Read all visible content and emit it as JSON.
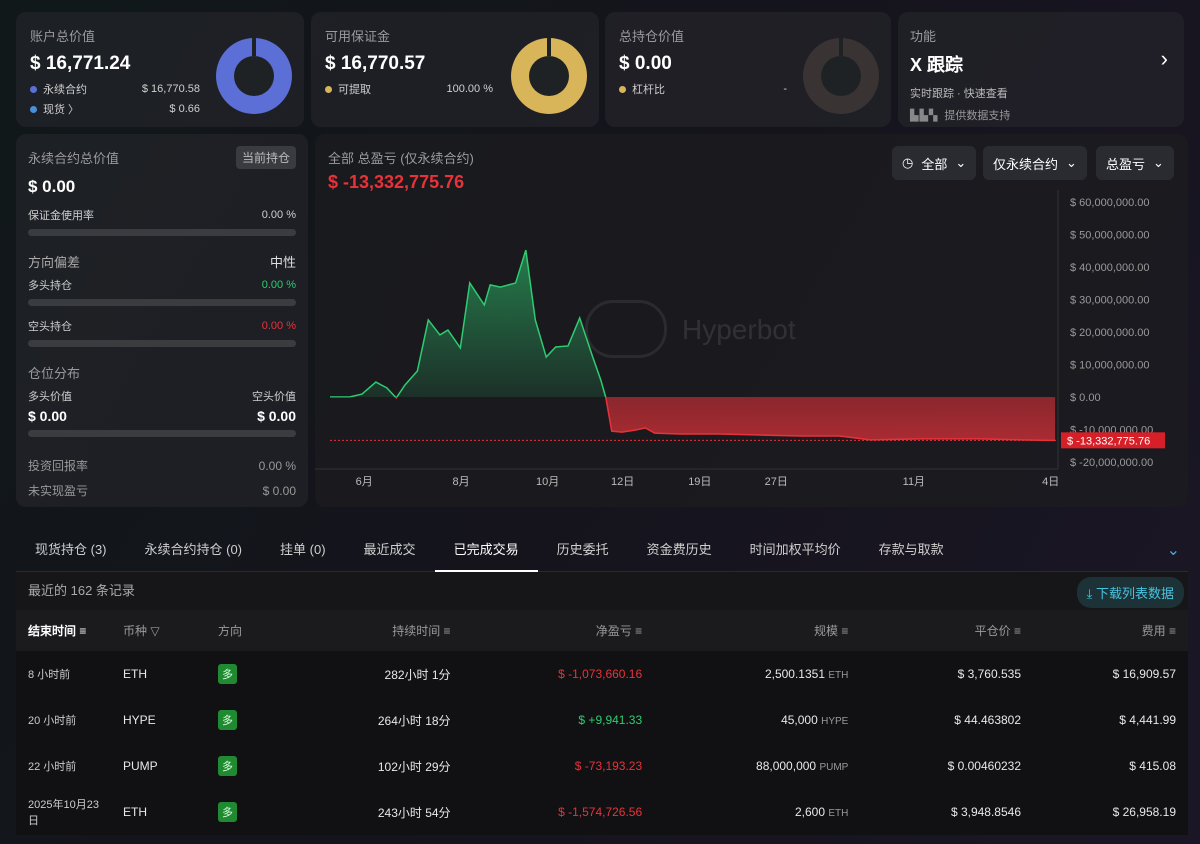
{
  "cards": {
    "total": {
      "label": "账户总价值",
      "value": "$ 16,771.24",
      "items": [
        {
          "label": "永续合约",
          "value": "$ 16,770.58",
          "color": "#5b6fd6"
        },
        {
          "label": "现货 〉",
          "value": "$ 0.66",
          "color": "#4a90d9"
        }
      ]
    },
    "margin": {
      "label": "可用保证金",
      "value": "$ 16,770.57",
      "items": [
        {
          "label": "可提取",
          "value": "100.00 %",
          "color": "#d9b55a"
        }
      ]
    },
    "position": {
      "label": "总持仓价值",
      "value": "$ 0.00",
      "items": [
        {
          "label": "杠杆比",
          "value": "-",
          "color": "#d9b55a"
        }
      ]
    },
    "feature": {
      "label": "功能",
      "title": "X 跟踪",
      "sub": "实时跟踪 · 快速查看",
      "provider_logo": "bbx",
      "provider": "提供数据支持"
    }
  },
  "perp": {
    "title": "永续合约总价值",
    "badge": "当前持仓",
    "value": "$ 0.00",
    "margin_rate_label": "保证金使用率",
    "margin_rate": "0.00 %",
    "bias_label": "方向偏差",
    "bias": "中性",
    "long_label": "多头持仓",
    "long_pct": "0.00 %",
    "short_label": "空头持仓",
    "short_pct": "0.00 %",
    "dist_label": "仓位分布",
    "long_val_label": "多头价值",
    "short_val_label": "空头价值",
    "long_val": "$ 0.00",
    "short_val": "$ 0.00",
    "roi_label": "投资回报率",
    "roi": "0.00 %",
    "upnl_label": "未实现盈亏",
    "upnl": "$ 0.00"
  },
  "chart_head": {
    "title": "全部 总盈亏 (仅永续合约)",
    "value": "$ -13,332,775.76",
    "filters": [
      "全部",
      "仅永续合约",
      "总盈亏"
    ],
    "watermark": "Hyperbot"
  },
  "chart_data": {
    "type": "area",
    "title": "全部 总盈亏 (仅永续合约)",
    "ylim": [
      -20000000,
      65000000
    ],
    "yticks": [
      {
        "v": 60000000,
        "l": "$ 60,000,000.00"
      },
      {
        "v": 50000000,
        "l": "$ 50,000,000.00"
      },
      {
        "v": 40000000,
        "l": "$ 40,000,000.00"
      },
      {
        "v": 30000000,
        "l": "$ 30,000,000.00"
      },
      {
        "v": 20000000,
        "l": "$ 20,000,000.00"
      },
      {
        "v": 10000000,
        "l": "$ 10,000,000.00"
      },
      {
        "v": 0,
        "l": "$ 0.00"
      },
      {
        "v": -10000000,
        "l": "$ -10,000,000.00"
      },
      {
        "v": -20000000,
        "l": "$ -20,000,000.00"
      }
    ],
    "xticks": [
      {
        "t": 4.7,
        "l": "6月"
      },
      {
        "t": 18,
        "l": "8月"
      },
      {
        "t": 29.9,
        "l": "10月"
      },
      {
        "t": 40.2,
        "l": "12日"
      },
      {
        "t": 50.8,
        "l": "19日"
      },
      {
        "t": 61.3,
        "l": "27日"
      },
      {
        "t": 80.2,
        "l": "11月"
      },
      {
        "t": 99,
        "l": "4日"
      }
    ],
    "last_label": "$ -13,332,775.76",
    "last_value": -13332775.76,
    "points": [
      [
        0,
        0
      ],
      [
        2.7,
        0
      ],
      [
        4.4,
        0.9
      ],
      [
        6.3,
        4.6
      ],
      [
        7.8,
        2.8
      ],
      [
        9.1,
        -0.3
      ],
      [
        10.3,
        3.7
      ],
      [
        12,
        8
      ],
      [
        13.5,
        23.7
      ],
      [
        15.1,
        19.1
      ],
      [
        16.2,
        20.6
      ],
      [
        17.9,
        15.1
      ],
      [
        19.2,
        35.1
      ],
      [
        21.2,
        28.3
      ],
      [
        22,
        34.5
      ],
      [
        23.4,
        33.8
      ],
      [
        25.5,
        35.1
      ],
      [
        26.9,
        45.2
      ],
      [
        28.2,
        23.7
      ],
      [
        29.7,
        12.3
      ],
      [
        31,
        15.4
      ],
      [
        32.7,
        15.7
      ],
      [
        34.3,
        24.3
      ],
      [
        36,
        12.9
      ],
      [
        37.2,
        5.2
      ],
      [
        37.9,
        -0.3
      ],
      [
        38.7,
        -10.5
      ],
      [
        40.1,
        -10.8
      ],
      [
        41.9,
        -10.2
      ],
      [
        43.3,
        -9.5
      ],
      [
        44.6,
        -11.1
      ],
      [
        48.1,
        -11.4
      ],
      [
        53.6,
        -11.4
      ],
      [
        59.1,
        -11.7
      ],
      [
        64.6,
        -12
      ],
      [
        70,
        -12
      ],
      [
        74.2,
        -13.2
      ],
      [
        81,
        -12.9
      ],
      [
        89.3,
        -12.9
      ],
      [
        97.5,
        -13.3
      ],
      [
        99.6,
        -13.33
      ]
    ],
    "unit": "million USD"
  },
  "tabs": [
    "现货持仓 (3)",
    "永续合约持仓 (0)",
    "挂单 (0)",
    "最近成交",
    "已完成交易",
    "历史委托",
    "资金费历史",
    "时间加权平均价",
    "存款与取款"
  ],
  "records": "最近的 162 条记录",
  "download": "下载列表数据",
  "columns": [
    "结束时间",
    "币种",
    "方向",
    "持续时间",
    "净盈亏",
    "规模",
    "平仓价",
    "费用"
  ],
  "rows": [
    {
      "time": "8 小时前",
      "coin": "ETH",
      "dir": "多",
      "dur": "282小时 1分",
      "pnl": "$ -1,073,660.16",
      "neg": true,
      "size": "2,500.1351",
      "unit": "ETH",
      "price": "$ 3,760.535",
      "fee": "$ 16,909.57"
    },
    {
      "time": "20 小时前",
      "coin": "HYPE",
      "dir": "多",
      "dur": "264小时 18分",
      "pnl": "$ +9,941.33",
      "neg": false,
      "size": "45,000",
      "unit": "HYPE",
      "price": "$ 44.463802",
      "fee": "$ 4,441.99"
    },
    {
      "time": "22 小时前",
      "coin": "PUMP",
      "dir": "多",
      "dur": "102小时 29分",
      "pnl": "$ -73,193.23",
      "neg": true,
      "size": "88,000,000",
      "unit": "PUMP",
      "price": "$ 0.00460232",
      "fee": "$ 415.08"
    },
    {
      "time": "2025年10月23日",
      "coin": "ETH",
      "dir": "多",
      "dur": "243小时 54分",
      "pnl": "$ -1,574,726.56",
      "neg": true,
      "size": "2,600",
      "unit": "ETH",
      "price": "$ 3,948.8546",
      "fee": "$ 26,958.19"
    }
  ]
}
